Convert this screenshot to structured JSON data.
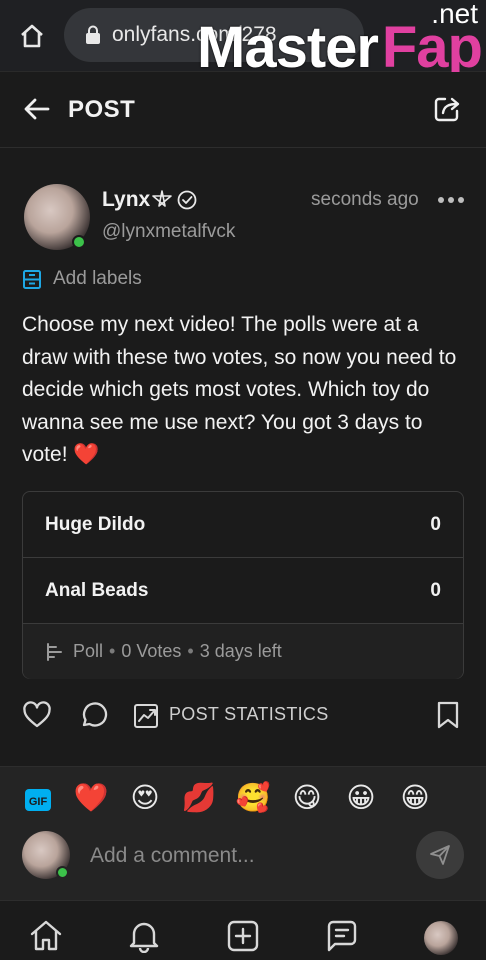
{
  "browser": {
    "url": "onlyfans.com/278",
    "watermark": {
      "main": "Master",
      "accent": "Fap",
      "tld": ".net"
    }
  },
  "header": {
    "title": "POST"
  },
  "post": {
    "author_name": "Lynx",
    "author_handle": "@lynxmetalfvck",
    "time": "seconds ago",
    "labels_text": "Add labels",
    "body": "Choose my next video! The polls were at a draw with these two votes, so now you need to decide which gets most votes. Which toy do wanna see me use next? You got 3 days to vote!",
    "body_emoji": "❤️"
  },
  "poll": {
    "options": [
      {
        "label": "Huge Dildo",
        "count": "0"
      },
      {
        "label": "Anal Beads",
        "count": "0"
      }
    ],
    "type_label": "Poll",
    "votes": "0 Votes",
    "time_left": "3 days left"
  },
  "actions": {
    "stats_label": "POST STATISTICS"
  },
  "reactions": {
    "emojis": [
      "❤️",
      "😍",
      "💋",
      "🥰",
      "😋",
      "😀",
      "😁"
    ]
  },
  "comment": {
    "placeholder": "Add a comment..."
  },
  "colors": {
    "background": "#1b1b1b",
    "accent_blue": "#00aff0",
    "online_green": "#3cc24a"
  }
}
